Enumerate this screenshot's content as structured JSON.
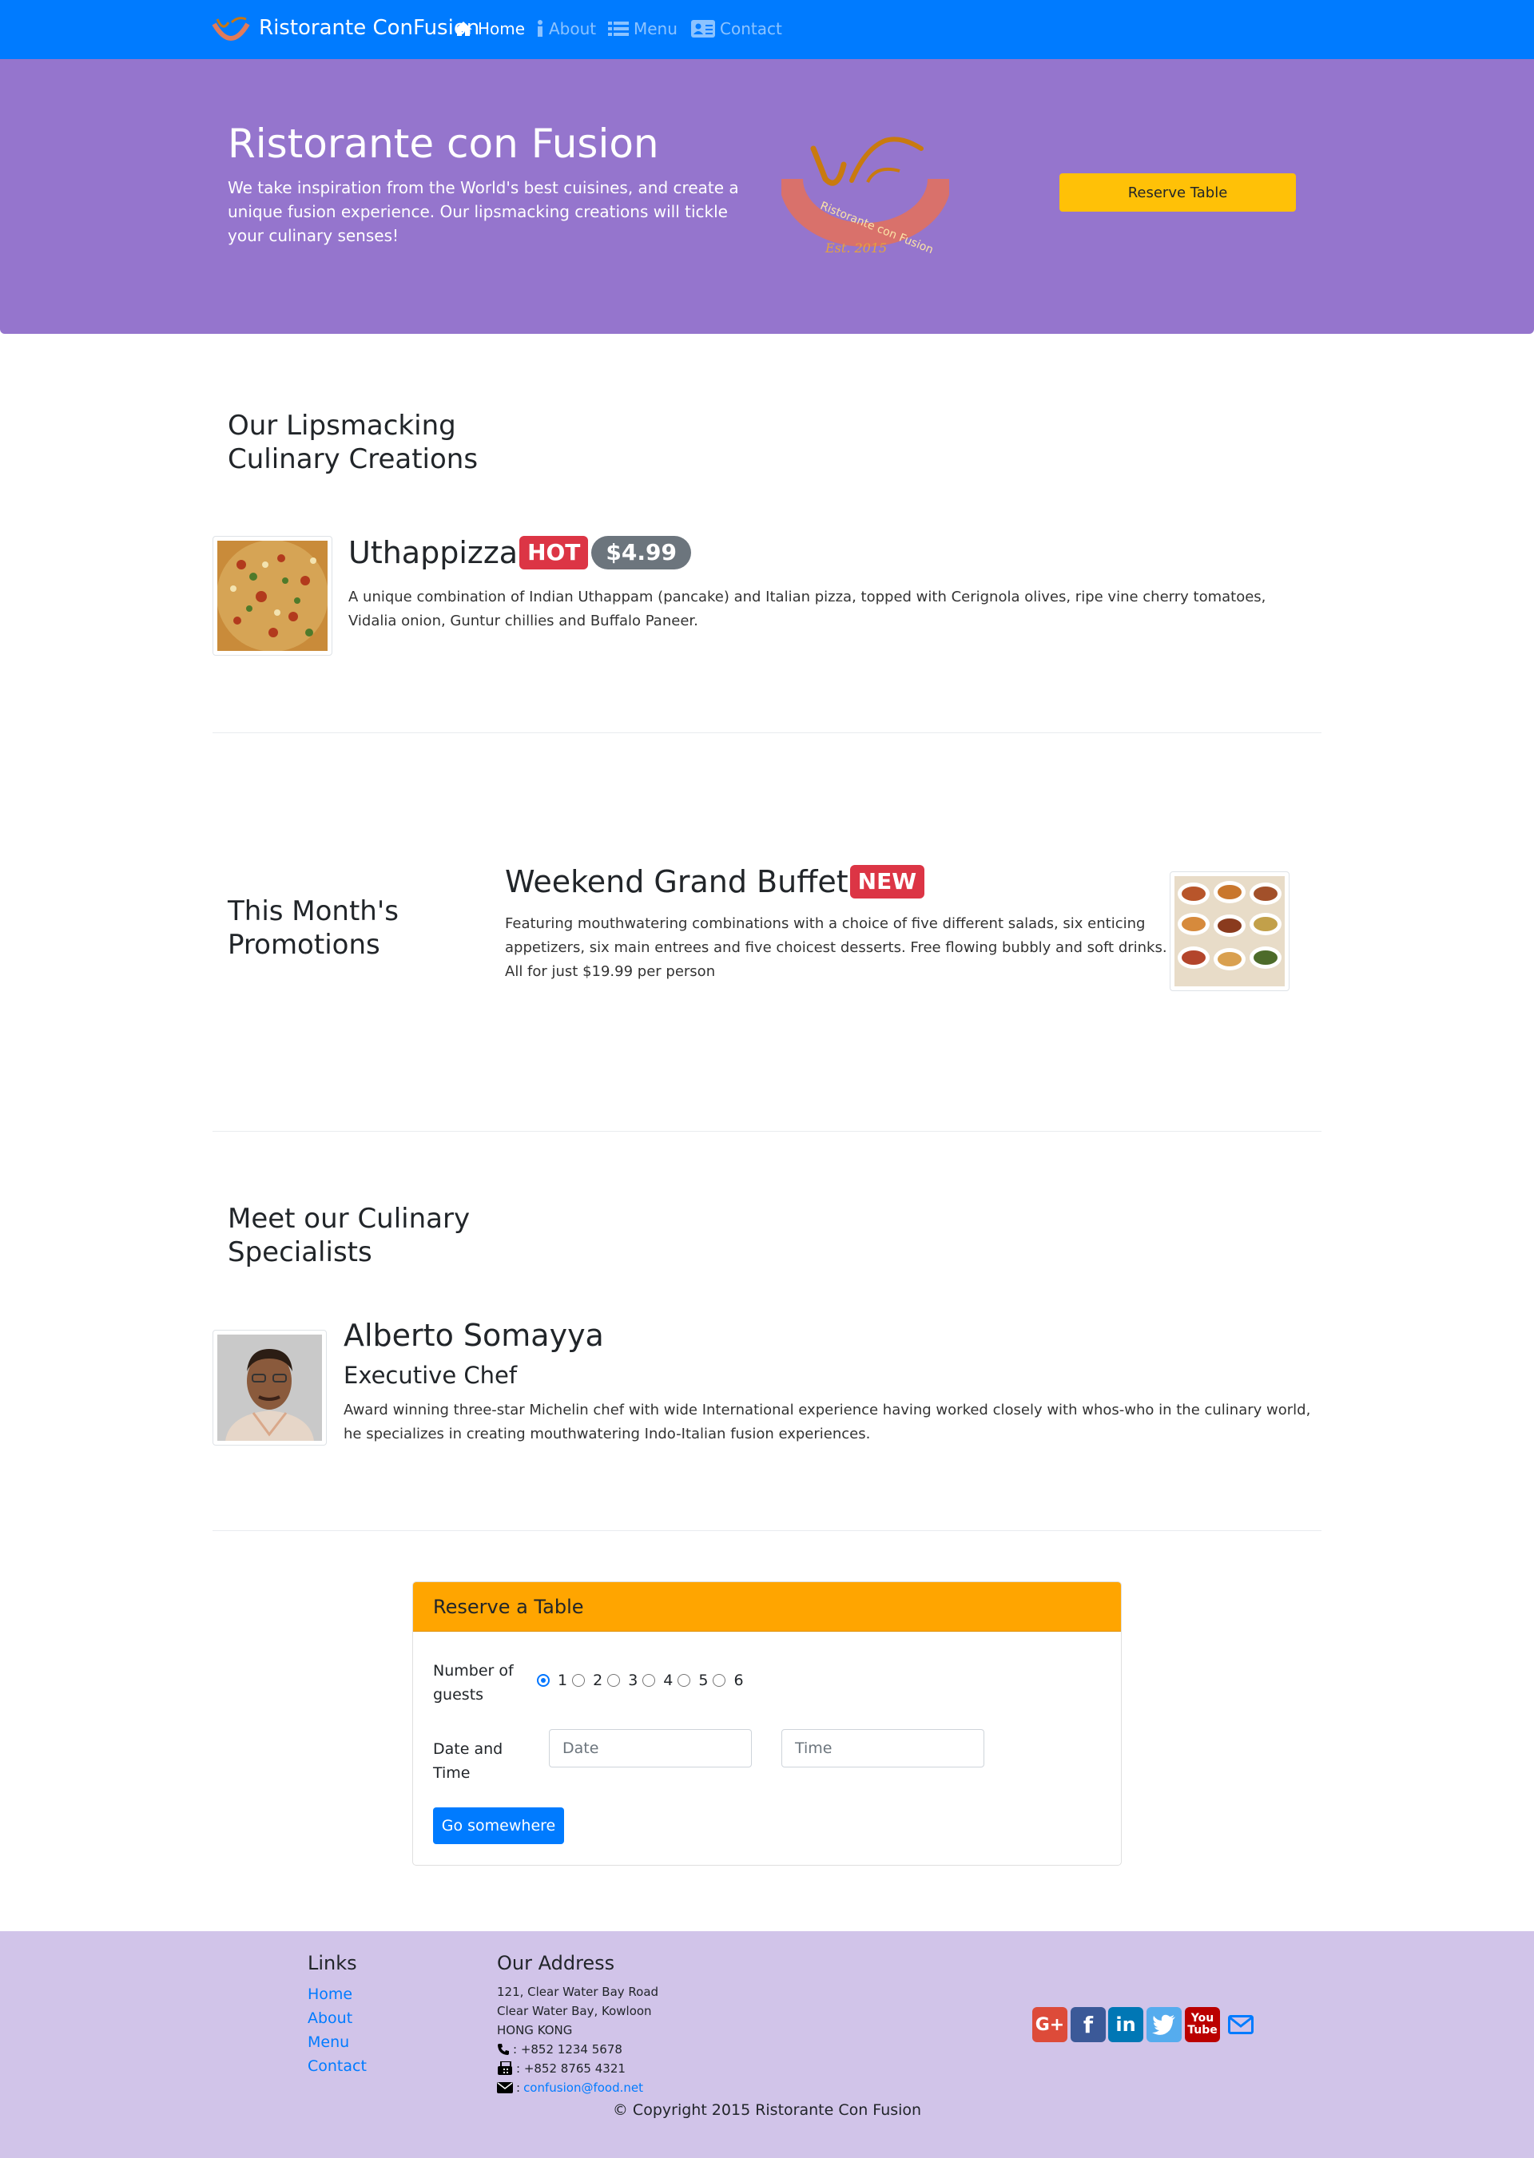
{
  "navbar": {
    "brand": "Ristorante ConFusion",
    "items": [
      {
        "label": "Home",
        "icon": "home-icon"
      },
      {
        "label": "About",
        "icon": "info-icon"
      },
      {
        "label": "Menu",
        "icon": "list-icon"
      },
      {
        "label": "Contact",
        "icon": "address-card-icon"
      }
    ],
    "color": "#007bff"
  },
  "jumbotron": {
    "title": "Ristorante con Fusion",
    "description": "We take inspiration from the World's best cuisines, and create a unique fusion experience. Our lipsmacking creations will tickle your culinary senses!",
    "logo_text": "Ristorante con Fusion",
    "logo_est": "Est. 2015",
    "reserve_button": "Reserve Table",
    "color": "#9575cd"
  },
  "creations": {
    "heading": "Our Lipsmacking Culinary Creations",
    "dish": {
      "name": "Uthappizza",
      "badge": "HOT",
      "price": "$4.99",
      "description": "A unique combination of Indian Uthappam (pancake) and Italian pizza, topped with Cerignola olives, ripe vine cherry tomatoes, Vidalia onion, Guntur chillies and Buffalo Paneer."
    }
  },
  "promotions": {
    "heading": "This Month's Promotions",
    "promo": {
      "name": "Weekend Grand Buffet",
      "badge": "NEW",
      "description": "Featuring mouthwatering combinations with a choice of five different salads, six enticing appetizers, six main entrees and five choicest desserts. Free flowing bubbly and soft drinks. All for just $19.99 per person"
    }
  },
  "specialists": {
    "heading": "Meet our Culinary Specialists",
    "leader": {
      "name": "Alberto Somayya",
      "designation": "Executive Chef",
      "description": "Award winning three-star Michelin chef with wide International experience having worked closely with whos-who in the culinary world, he specializes in creating mouthwatering Indo-Italian fusion experiences."
    }
  },
  "reservation": {
    "title": "Reserve a Table",
    "guests_label": "Number of guests",
    "guest_options": [
      "1",
      "2",
      "3",
      "4",
      "5",
      "6"
    ],
    "selected_guests": "1",
    "datetime_label": "Date and Time",
    "date_placeholder": "Date",
    "time_placeholder": "Time",
    "submit": "Go somewhere",
    "header_color": "#ffa500"
  },
  "footer": {
    "links_heading": "Links",
    "links": [
      "Home",
      "About",
      "Menu",
      "Contact"
    ],
    "address_heading": "Our Address",
    "address_lines": [
      "121, Clear Water Bay Road",
      "Clear Water Bay, Kowloon",
      "HONG KONG"
    ],
    "phone": ": +852 1234 5678",
    "fax": ": +852 8765 4321",
    "email_prefix": ":",
    "email": "confusion@food.net",
    "social_icons": [
      "google-plus-icon",
      "facebook-icon",
      "linkedin-icon",
      "twitter-icon",
      "youtube-icon",
      "envelope-icon"
    ],
    "copyright": "© Copyright 2015 Ristorante Con Fusion",
    "color": "#d1c4e9"
  }
}
